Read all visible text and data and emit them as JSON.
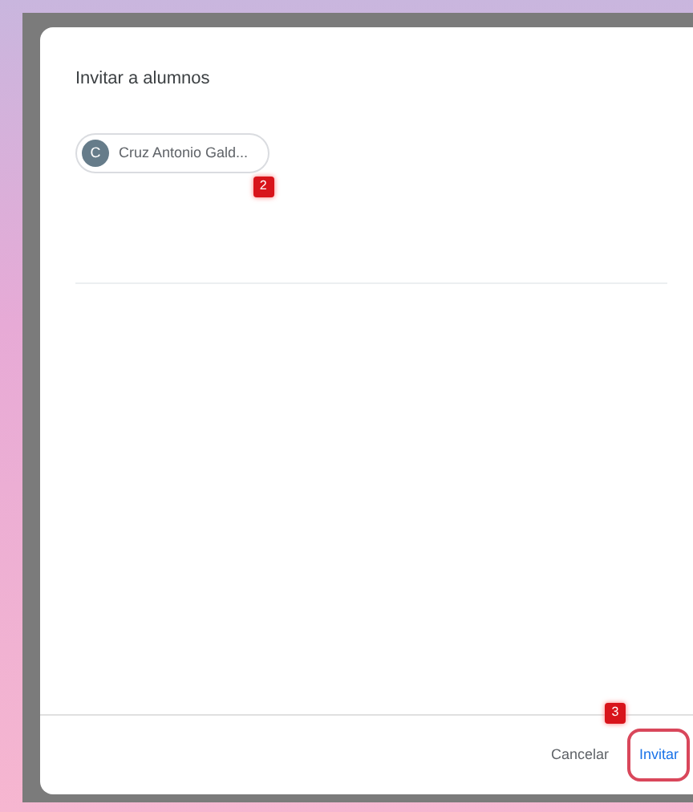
{
  "dialog": {
    "title": "Invitar a alumnos",
    "chips": [
      {
        "initial": "C",
        "label": "Cruz Antonio Gald...",
        "step": "2"
      }
    ],
    "buttons": [
      {
        "label": "Cancelar",
        "highlighted": false
      },
      {
        "label": "Invitar",
        "highlighted": true,
        "step": "3"
      }
    ]
  }
}
